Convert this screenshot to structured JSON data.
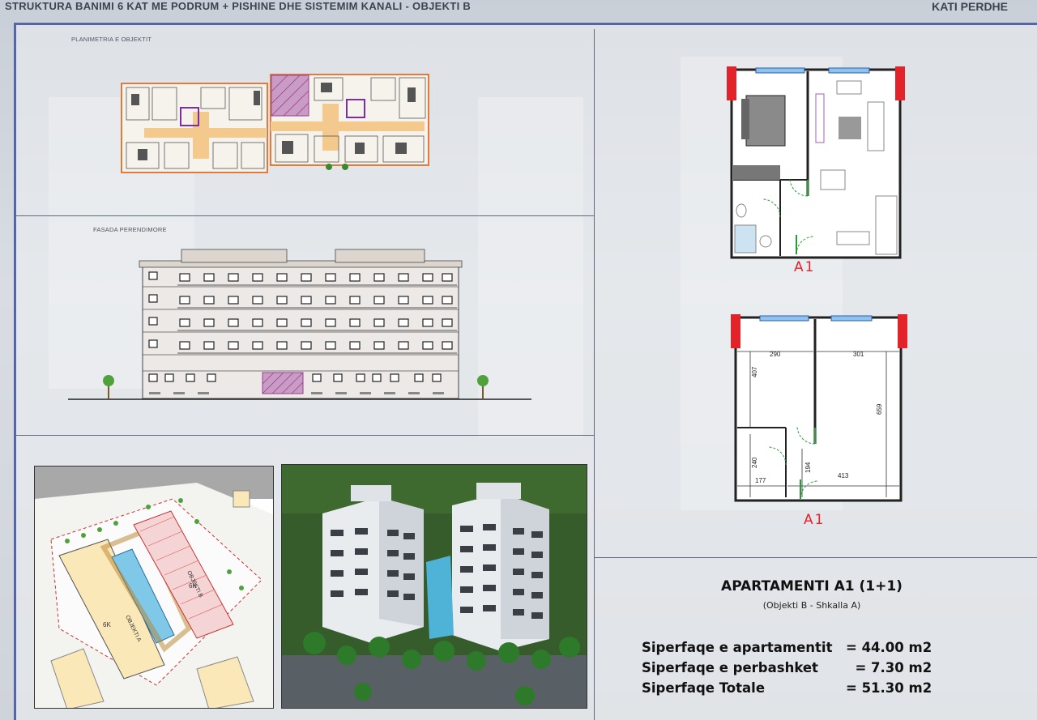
{
  "header": {
    "title": "STRUKTURA BANIMI 6 KAT ME PODRUM + PISHINE DHE SISTEMIM KANALI   -  OBJEKTI B",
    "floor": "KATI PERDHE"
  },
  "sections": {
    "floor_plan_label": "PLANIMETRIA E OBJEKTIT",
    "facade_label": "FASADA PERENDIMORE"
  },
  "apartment": {
    "plan_label_top": "A1",
    "plan_label_bottom": "A1",
    "title": "APARTAMENTI A1 (1+1)",
    "subtitle": "(Objekti B - Shkalla A)",
    "areas": [
      {
        "label": "Siperfaqe e apartamentit",
        "value": "= 44.00 m2"
      },
      {
        "label": "Siperfaqe e perbashket",
        "value": "  = 7.30 m2"
      },
      {
        "label": "Siperfaqe Totale",
        "value": "= 51.30 m2"
      }
    ]
  },
  "dimensions": {
    "d290": "290",
    "d301": "301",
    "d407": "407",
    "d659": "659",
    "d240": "240",
    "d194": "194",
    "d177": "177",
    "d413": "413"
  },
  "site_plan": {
    "building_a": "OBJEKTI A",
    "building_b": "OBJEKTI B",
    "floors_a": "6K",
    "floors_b": "6K"
  },
  "colors": {
    "frame": "#5566a6",
    "accent_red": "#e2232a",
    "hatch_purple": "#9b3d8f",
    "plan_orange": "#e07b39"
  }
}
